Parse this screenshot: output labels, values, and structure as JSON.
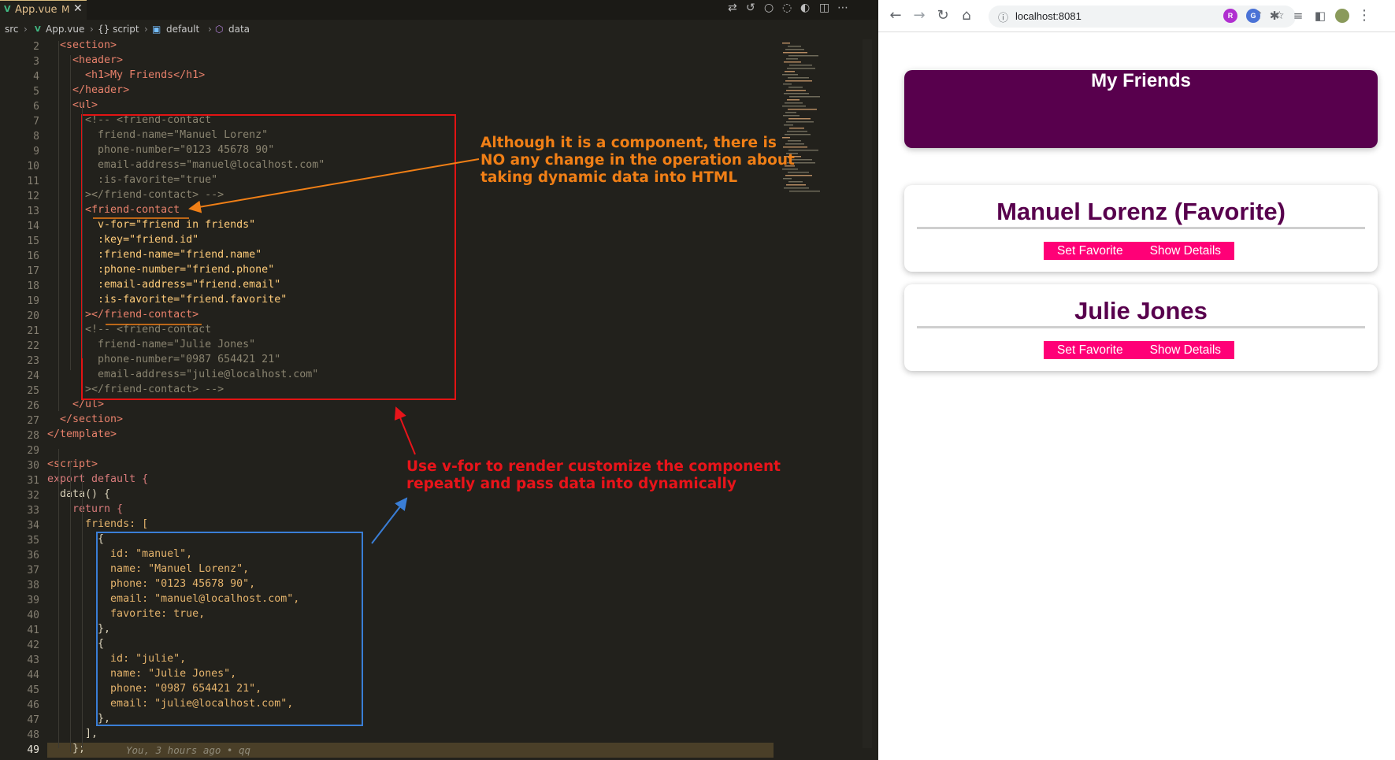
{
  "editor": {
    "tab": {
      "icon": "vue-icon",
      "filename": "App.vue",
      "modified": "M"
    },
    "breadcrumb": [
      "src",
      "App.vue",
      "{} script",
      "default",
      "data"
    ],
    "line_numbers": [
      "2",
      "3",
      "4",
      "5",
      "6",
      "7",
      "8",
      "9",
      "10",
      "11",
      "12",
      "13",
      "14",
      "15",
      "16",
      "17",
      "18",
      "19",
      "20",
      "21",
      "22",
      "23",
      "24",
      "25",
      "26",
      "27",
      "28",
      "29",
      "30",
      "31",
      "32",
      "33",
      "34",
      "35",
      "36",
      "37",
      "38",
      "39",
      "40",
      "41",
      "42",
      "43",
      "44",
      "45",
      "46",
      "47",
      "48",
      "49"
    ],
    "lines": [
      "  <section>",
      "    <header>",
      "      <h1>My Friends</h1>",
      "    </header>",
      "    <ul>",
      "      <!-- <friend-contact",
      "        friend-name=\"Manuel Lorenz\"",
      "        phone-number=\"0123 45678 90\"",
      "        email-address=\"manuel@localhost.com\"",
      "        :is-favorite=\"true\"",
      "      ></friend-contact> -->",
      "      <friend-contact",
      "        v-for=\"friend in friends\"",
      "        :key=\"friend.id\"",
      "        :friend-name=\"friend.name\"",
      "        :phone-number=\"friend.phone\"",
      "        :email-address=\"friend.email\"",
      "        :is-favorite=\"friend.favorite\"",
      "      ></friend-contact>",
      "      <!-- <friend-contact",
      "        friend-name=\"Julie Jones\"",
      "        phone-number=\"0987 654421 21\"",
      "        email-address=\"julie@localhost.com\"",
      "      ></friend-contact> -->",
      "    </ul>",
      "  </section>",
      "</template>",
      "",
      "<script>",
      "export default {",
      "  data() {",
      "    return {",
      "      friends: [",
      "        {",
      "          id: \"manuel\",",
      "          name: \"Manuel Lorenz\",",
      "          phone: \"0123 45678 90\",",
      "          email: \"manuel@localhost.com\",",
      "          favorite: true,",
      "        },",
      "        {",
      "          id: \"julie\",",
      "          name: \"Julie Jones\",",
      "          phone: \"0987 654421 21\",",
      "          email: \"julie@localhost.com\",",
      "        },",
      "      ],",
      "    };"
    ],
    "blame": "You, 3 hours ago • qq"
  },
  "annotations": {
    "orange_note": [
      "Although it is a component, there is",
      "NO any change in the operation about",
      "taking dynamic data into HTML"
    ],
    "red_note": [
      "Use v-for to render customize the component",
      "repeatly and pass data into dynamically"
    ],
    "colors": {
      "orange": "#f07f16",
      "red": "#e8141a",
      "blue": "#3a7ed6"
    }
  },
  "browser": {
    "url": "localhost:8081",
    "nav_icons": [
      "back-icon",
      "forward-icon",
      "reload-icon",
      "home-icon"
    ],
    "page": {
      "title": "My Friends",
      "friends": [
        {
          "heading": "Manuel Lorenz (Favorite)",
          "set_favorite": "Set Favorite",
          "show_details": "Show Details"
        },
        {
          "heading": "Julie Jones",
          "set_favorite": "Set Favorite",
          "show_details": "Show Details"
        }
      ],
      "colors": {
        "header_bg": "#58004d",
        "heading_text": "#58004d",
        "button_bg": "#ff0077"
      }
    }
  }
}
